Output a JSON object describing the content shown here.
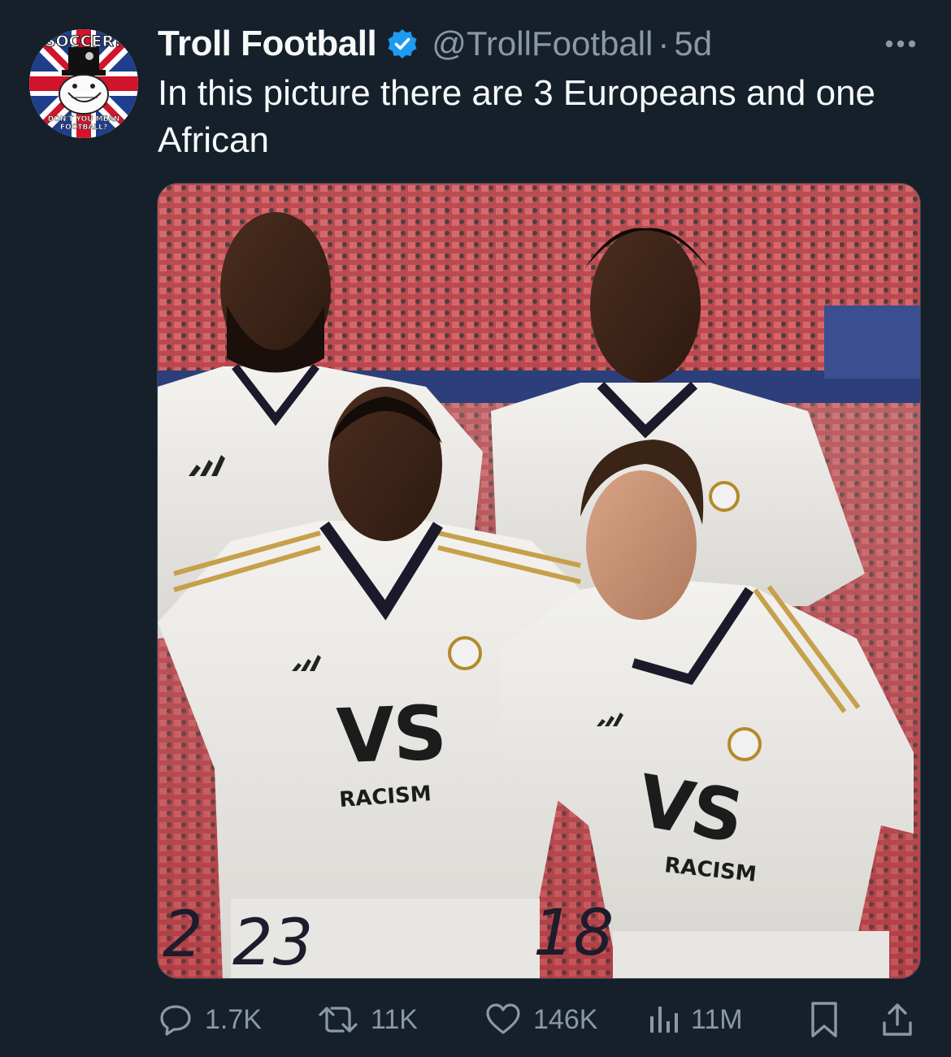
{
  "account": {
    "display_name": "Troll Football",
    "handle": "@TrollFootball",
    "separator": "·",
    "time": "5d",
    "verified": true,
    "avatar_text_top": "SOCCER?",
    "avatar_text_bottom_line1": "DON'T YOU MEAN",
    "avatar_text_bottom_line2": "FOOTBALL?"
  },
  "tweet": {
    "text": "In this picture there are 3 Europeans and one African"
  },
  "media": {
    "jersey_vs_1": "VS",
    "jersey_racism_1": "RACISM",
    "jersey_vs_2": "VS",
    "jersey_racism_2": "RACISM",
    "number_left_partial": "2",
    "number_1": "23",
    "number_2": "18"
  },
  "actions": {
    "replies": "1.7K",
    "reposts": "11K",
    "likes": "146K",
    "views": "11M"
  },
  "colors": {
    "background": "#15202b",
    "text_primary": "#f7f9f9",
    "text_secondary": "#8b98a5",
    "verified_blue": "#1d9bf0"
  },
  "icons": {
    "more": "more-icon",
    "reply": "reply-icon",
    "repost": "repost-icon",
    "like": "heart-icon",
    "views": "views-icon",
    "bookmark": "bookmark-icon",
    "share": "share-icon",
    "verified": "verified-badge-icon"
  }
}
